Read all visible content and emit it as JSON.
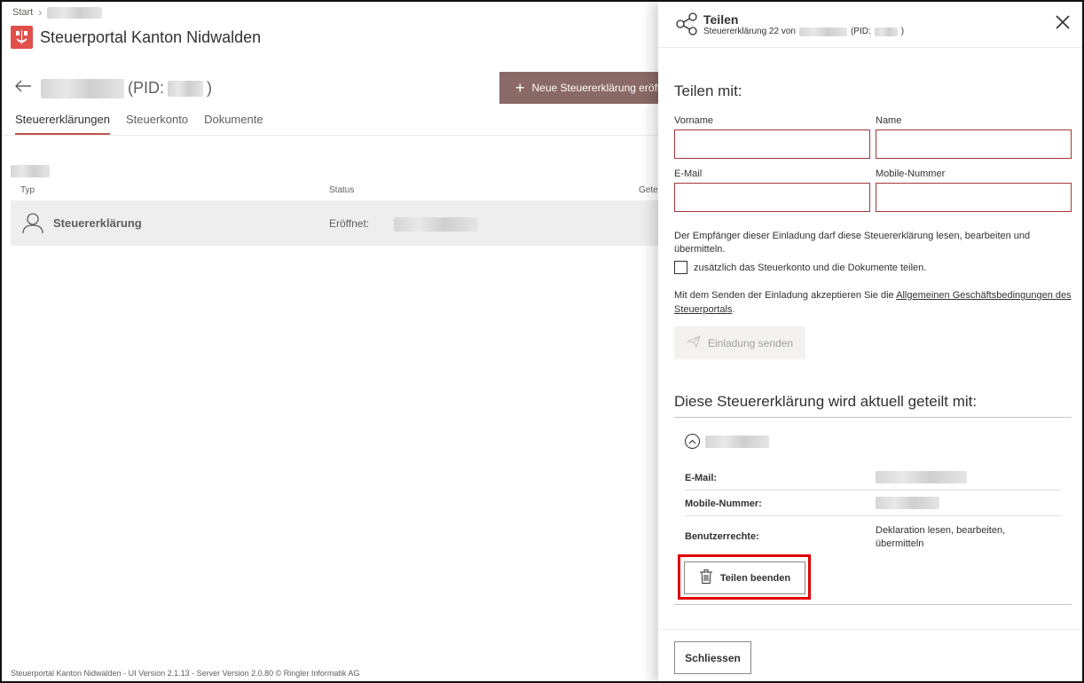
{
  "breadcrumb": {
    "start": "Start",
    "separator": "›"
  },
  "brand": {
    "title": "Steuerportal Kanton Nidwalden"
  },
  "taxpayer": {
    "pid_prefix": "(PID:",
    "pid_suffix": ")"
  },
  "actions": {
    "new_return": "Neue Steuererklärung eröffnen"
  },
  "tabs": [
    {
      "label": "Steuererklärungen",
      "active": true
    },
    {
      "label": "Steuerkonto",
      "active": false
    },
    {
      "label": "Dokumente",
      "active": false
    }
  ],
  "table": {
    "columns": [
      "Typ",
      "Status",
      "Geteilt"
    ],
    "rows": [
      {
        "type": "Steuererklärung",
        "status": "Eröffnet:"
      }
    ]
  },
  "footer": {
    "text": "Steuerportal Kanton Nidwalden - UI Version 2.1.13 - Server Version 2.0.80 © Ringler Informatik AG"
  },
  "panel": {
    "title": "Teilen",
    "subtitle_prefix": "Steuererklärung 22 von",
    "subtitle_pid": "(PID:",
    "subtitle_suffix": ")",
    "share_with_heading": "Teilen mit:",
    "fields": {
      "firstname_label": "Vorname",
      "lastname_label": "Name",
      "email_label": "E-Mail",
      "mobile_label": "Mobile-Nummer",
      "firstname_value": "",
      "lastname_value": "",
      "email_value": "",
      "mobile_value": ""
    },
    "info_text": "Der Empfänger dieser Einladung darf diese Steuererklärung lesen, bearbeiten und übermitteln.",
    "checkbox_label": "zusätzlich das Steuerkonto und die Dokumente teilen.",
    "terms_prefix": "Mit dem Senden der Einladung akzeptieren Sie die ",
    "terms_link": "Allgemeinen Geschäftsbedingungen des Steuerportals",
    "terms_suffix": ".",
    "send_button": "Einladung senden",
    "shared_heading": "Diese Steuererklärung wird aktuell geteilt mit:",
    "shared_details": {
      "email_label": "E-Mail:",
      "mobile_label": "Mobile-Nummer:",
      "rights_label": "Benutzerrechte:",
      "rights_value": "Deklaration lesen, bearbeiten, übermitteln"
    },
    "end_share_button": "Teilen beenden",
    "close_button": "Schliessen"
  },
  "colors": {
    "accent": "#c4534f",
    "primary_button": "#8a6a66",
    "highlight": "#e00000",
    "input_border": "#a4373a"
  },
  "icons": [
    "share-icon",
    "close-icon",
    "back-arrow-icon",
    "plus-icon",
    "person-icon",
    "send-icon",
    "chevron-up-icon",
    "trash-icon",
    "logo-icon"
  ]
}
